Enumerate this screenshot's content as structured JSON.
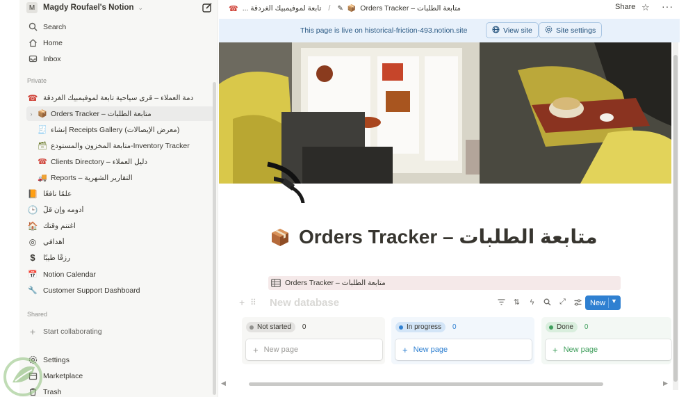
{
  "workspace": {
    "avatar_letter": "M",
    "name": "Magdy Roufael's Notion"
  },
  "sidebar": {
    "top": [
      {
        "label": "Search",
        "icon": "search-icon"
      },
      {
        "label": "Home",
        "icon": "home-icon"
      },
      {
        "label": "Inbox",
        "icon": "inbox-icon"
      }
    ],
    "private_label": "Private",
    "private": [
      {
        "label": "دمة العملاء – قرى سياحية تابعة لموفيمبيك الغردقة",
        "icon": "☎"
      },
      {
        "label": "Orders Tracker – متابعة الطلبات",
        "icon": "📦"
      },
      {
        "label": "إنشاء Receipts Gallery (معرض الإيصالات)",
        "icon": "🧾"
      },
      {
        "label": "متابعة المخزون والمستودع-Inventory Tracker",
        "icon": "🗃"
      },
      {
        "label": "Clients Directory – دليل العملاء",
        "icon": "☎"
      },
      {
        "label": "Reports – التقارير الشهرية",
        "icon": "🚚"
      },
      {
        "label": "علمًا نافعًا",
        "icon": "📙"
      },
      {
        "label": "أدومه وإن قلّ",
        "icon": "🕒"
      },
      {
        "label": "اغتنم وقتك",
        "icon": "🏠"
      },
      {
        "label": "أهدافي",
        "icon": "◎"
      },
      {
        "label": "رزقًا طيبًا",
        "icon": "$"
      },
      {
        "label": "Notion Calendar",
        "icon": "📅"
      },
      {
        "label": "Customer Support Dashboard",
        "icon": "🔧"
      }
    ],
    "shared_label": "Shared",
    "shared": [
      {
        "label": "Start collaborating",
        "icon": "+"
      }
    ],
    "bottom": [
      {
        "label": "Settings",
        "icon": "gear-icon"
      },
      {
        "label": "Marketplace",
        "icon": "marketplace-icon"
      },
      {
        "label": "Trash",
        "icon": "trash-icon"
      }
    ]
  },
  "topbar": {
    "crumb1": "... تابعة لموفيمبيك الغردقة",
    "crumb2": "Orders Tracker – متابعة الطلبات",
    "share": "Share"
  },
  "banner": {
    "text": "This page is live on historical-friction-493.notion.site",
    "view_site": "View site",
    "site_settings": "Site settings"
  },
  "page": {
    "title": "Orders Tracker – متابعة الطلبات"
  },
  "database": {
    "view_tab": "Orders Tracker – متابعة الطلبات",
    "title_placeholder": "New database",
    "new_button": "New",
    "columns": [
      {
        "status": "Not started",
        "count": "0",
        "new_page": "New page",
        "bg": "#f7f7f5",
        "pill_bg": "#e3e2e0",
        "dot": "#91918e",
        "text": "#37352f"
      },
      {
        "status": "In progress",
        "count": "0",
        "new_page": "New page",
        "bg": "#f2f7fc",
        "pill_bg": "#d3e5f7",
        "dot": "#2f80d1",
        "text": "#2f80d1"
      },
      {
        "status": "Done",
        "count": "0",
        "new_page": "New page",
        "bg": "#f3f8f4",
        "pill_bg": "#d9eedd",
        "dot": "#3f9e5c",
        "text": "#3f9e5c"
      }
    ]
  }
}
